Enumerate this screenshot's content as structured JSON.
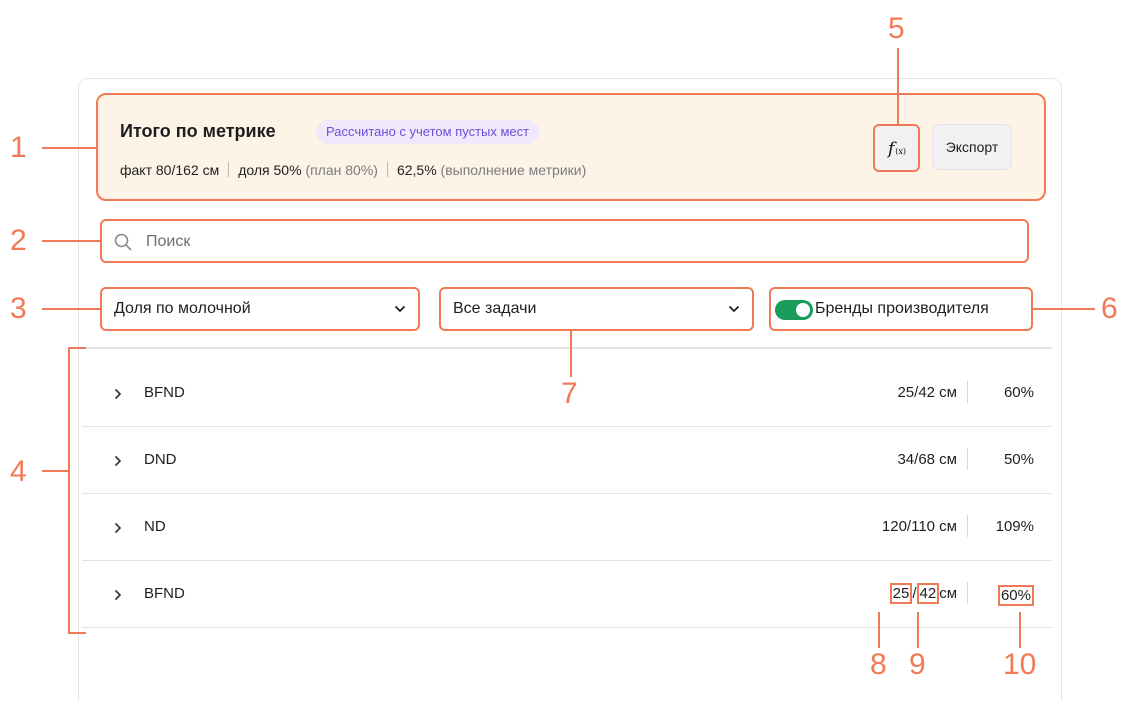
{
  "summary": {
    "title": "Итого по метрике",
    "badge": "Рассчитано с учетом пустых мест",
    "fact": "факт 80/162 см",
    "share": "доля 50%",
    "plan": "(план  80%)",
    "completion": "62,5%",
    "completion_label": "(выполнение метрики)",
    "fx_label": "f",
    "fx_sub": "(x)",
    "export_label": "Экспорт"
  },
  "search": {
    "placeholder": "Поиск",
    "value": ""
  },
  "filters": {
    "metric_select": "Доля по молочной",
    "task_select": "Все задачи",
    "toggle_label": "Бренды производителя",
    "toggle_on": true
  },
  "rows": [
    {
      "name": "BFND",
      "value": "25/42 см",
      "percent": "60%"
    },
    {
      "name": "DND",
      "value": "34/68 см",
      "percent": "50%"
    },
    {
      "name": "ND",
      "value": "120/110 см",
      "percent": "109%"
    },
    {
      "name": "BFND",
      "value_fact": "25",
      "value_sep": "/",
      "value_plan": "42",
      "unit": "см",
      "percent": "60%"
    }
  ],
  "annotations": {
    "n1": "1",
    "n2": "2",
    "n3": "3",
    "n4": "4",
    "n5": "5",
    "n6": "6",
    "n7": "7",
    "n8": "8",
    "n9": "9",
    "n10": "10"
  },
  "colors": {
    "annotation": "#f07a55",
    "summary_bg": "#fdf3e6",
    "badge_text": "#6b4fd8",
    "toggle_on": "#1a9c5b"
  }
}
